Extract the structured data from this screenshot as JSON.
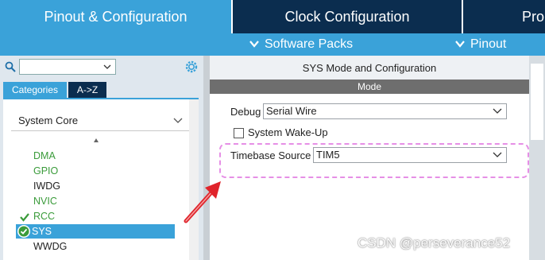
{
  "top_tabs": {
    "pinout_config": "Pinout & Configuration",
    "clock_config": "Clock Configuration",
    "project_partial": "Pro"
  },
  "sub_menu": {
    "software_packs": "Software Packs",
    "pinout": "Pinout"
  },
  "left_panel": {
    "search_value": "",
    "tabs": {
      "categories": "Categories",
      "az": "A->Z"
    },
    "section_title": "System Core",
    "peripherals": [
      {
        "label": "DMA",
        "status": "green"
      },
      {
        "label": "GPIO",
        "status": "green"
      },
      {
        "label": "IWDG",
        "status": "black"
      },
      {
        "label": "NVIC",
        "status": "green"
      },
      {
        "label": "RCC",
        "status": "green-checked"
      },
      {
        "label": "SYS",
        "status": "selected"
      },
      {
        "label": "WWDG",
        "status": "black"
      }
    ]
  },
  "right_panel": {
    "title": "SYS Mode and Configuration",
    "mode_header": "Mode",
    "debug_label": "Debug",
    "debug_value": "Serial Wire",
    "wakeup_label": "System Wake-Up",
    "wakeup_checked": false,
    "timebase_label": "Timebase Source",
    "timebase_value": "TIM5"
  },
  "watermark": "CSDN @perseverance52",
  "colors": {
    "accent_blue": "#3aa2d9",
    "dark_navy": "#0b2d4f",
    "green": "#3a9b3a",
    "highlight_pink": "#e68fe6",
    "arrow_red": "#e0242b"
  }
}
